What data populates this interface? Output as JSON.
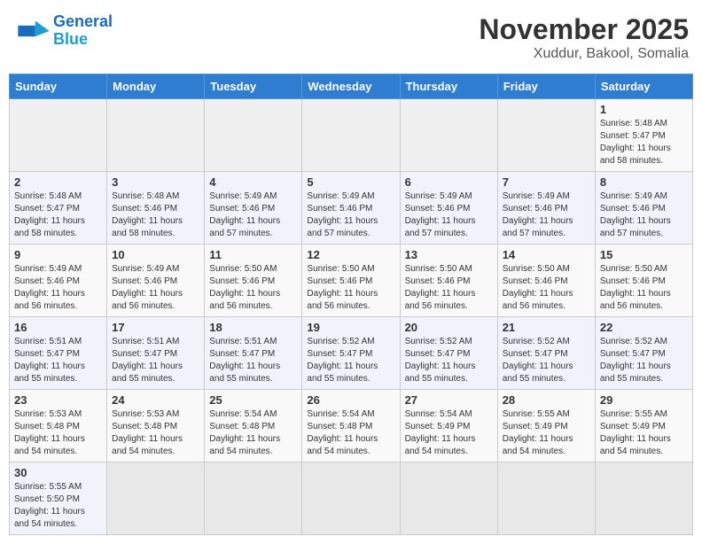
{
  "header": {
    "logo_general": "General",
    "logo_blue": "Blue",
    "month_title": "November 2025",
    "location": "Xuddur, Bakool, Somalia"
  },
  "days_of_week": [
    "Sunday",
    "Monday",
    "Tuesday",
    "Wednesday",
    "Thursday",
    "Friday",
    "Saturday"
  ],
  "weeks": [
    [
      {
        "day": "",
        "info": ""
      },
      {
        "day": "",
        "info": ""
      },
      {
        "day": "",
        "info": ""
      },
      {
        "day": "",
        "info": ""
      },
      {
        "day": "",
        "info": ""
      },
      {
        "day": "",
        "info": ""
      },
      {
        "day": "1",
        "info": "Sunrise: 5:48 AM\nSunset: 5:47 PM\nDaylight: 11 hours\nand 58 minutes."
      }
    ],
    [
      {
        "day": "2",
        "info": "Sunrise: 5:48 AM\nSunset: 5:47 PM\nDaylight: 11 hours\nand 58 minutes."
      },
      {
        "day": "3",
        "info": "Sunrise: 5:48 AM\nSunset: 5:46 PM\nDaylight: 11 hours\nand 58 minutes."
      },
      {
        "day": "4",
        "info": "Sunrise: 5:49 AM\nSunset: 5:46 PM\nDaylight: 11 hours\nand 57 minutes."
      },
      {
        "day": "5",
        "info": "Sunrise: 5:49 AM\nSunset: 5:46 PM\nDaylight: 11 hours\nand 57 minutes."
      },
      {
        "day": "6",
        "info": "Sunrise: 5:49 AM\nSunset: 5:46 PM\nDaylight: 11 hours\nand 57 minutes."
      },
      {
        "day": "7",
        "info": "Sunrise: 5:49 AM\nSunset: 5:46 PM\nDaylight: 11 hours\nand 57 minutes."
      },
      {
        "day": "8",
        "info": "Sunrise: 5:49 AM\nSunset: 5:46 PM\nDaylight: 11 hours\nand 57 minutes."
      }
    ],
    [
      {
        "day": "9",
        "info": "Sunrise: 5:49 AM\nSunset: 5:46 PM\nDaylight: 11 hours\nand 56 minutes."
      },
      {
        "day": "10",
        "info": "Sunrise: 5:49 AM\nSunset: 5:46 PM\nDaylight: 11 hours\nand 56 minutes."
      },
      {
        "day": "11",
        "info": "Sunrise: 5:50 AM\nSunset: 5:46 PM\nDaylight: 11 hours\nand 56 minutes."
      },
      {
        "day": "12",
        "info": "Sunrise: 5:50 AM\nSunset: 5:46 PM\nDaylight: 11 hours\nand 56 minutes."
      },
      {
        "day": "13",
        "info": "Sunrise: 5:50 AM\nSunset: 5:46 PM\nDaylight: 11 hours\nand 56 minutes."
      },
      {
        "day": "14",
        "info": "Sunrise: 5:50 AM\nSunset: 5:46 PM\nDaylight: 11 hours\nand 56 minutes."
      },
      {
        "day": "15",
        "info": "Sunrise: 5:50 AM\nSunset: 5:46 PM\nDaylight: 11 hours\nand 56 minutes."
      }
    ],
    [
      {
        "day": "16",
        "info": "Sunrise: 5:51 AM\nSunset: 5:47 PM\nDaylight: 11 hours\nand 55 minutes."
      },
      {
        "day": "17",
        "info": "Sunrise: 5:51 AM\nSunset: 5:47 PM\nDaylight: 11 hours\nand 55 minutes."
      },
      {
        "day": "18",
        "info": "Sunrise: 5:51 AM\nSunset: 5:47 PM\nDaylight: 11 hours\nand 55 minutes."
      },
      {
        "day": "19",
        "info": "Sunrise: 5:52 AM\nSunset: 5:47 PM\nDaylight: 11 hours\nand 55 minutes."
      },
      {
        "day": "20",
        "info": "Sunrise: 5:52 AM\nSunset: 5:47 PM\nDaylight: 11 hours\nand 55 minutes."
      },
      {
        "day": "21",
        "info": "Sunrise: 5:52 AM\nSunset: 5:47 PM\nDaylight: 11 hours\nand 55 minutes."
      },
      {
        "day": "22",
        "info": "Sunrise: 5:52 AM\nSunset: 5:47 PM\nDaylight: 11 hours\nand 55 minutes."
      }
    ],
    [
      {
        "day": "23",
        "info": "Sunrise: 5:53 AM\nSunset: 5:48 PM\nDaylight: 11 hours\nand 54 minutes."
      },
      {
        "day": "24",
        "info": "Sunrise: 5:53 AM\nSunset: 5:48 PM\nDaylight: 11 hours\nand 54 minutes."
      },
      {
        "day": "25",
        "info": "Sunrise: 5:54 AM\nSunset: 5:48 PM\nDaylight: 11 hours\nand 54 minutes."
      },
      {
        "day": "26",
        "info": "Sunrise: 5:54 AM\nSunset: 5:48 PM\nDaylight: 11 hours\nand 54 minutes."
      },
      {
        "day": "27",
        "info": "Sunrise: 5:54 AM\nSunset: 5:49 PM\nDaylight: 11 hours\nand 54 minutes."
      },
      {
        "day": "28",
        "info": "Sunrise: 5:55 AM\nSunset: 5:49 PM\nDaylight: 11 hours\nand 54 minutes."
      },
      {
        "day": "29",
        "info": "Sunrise: 5:55 AM\nSunset: 5:49 PM\nDaylight: 11 hours\nand 54 minutes."
      }
    ],
    [
      {
        "day": "30",
        "info": "Sunrise: 5:55 AM\nSunset: 5:50 PM\nDaylight: 11 hours\nand 54 minutes."
      },
      {
        "day": "",
        "info": ""
      },
      {
        "day": "",
        "info": ""
      },
      {
        "day": "",
        "info": ""
      },
      {
        "day": "",
        "info": ""
      },
      {
        "day": "",
        "info": ""
      },
      {
        "day": "",
        "info": ""
      }
    ]
  ]
}
